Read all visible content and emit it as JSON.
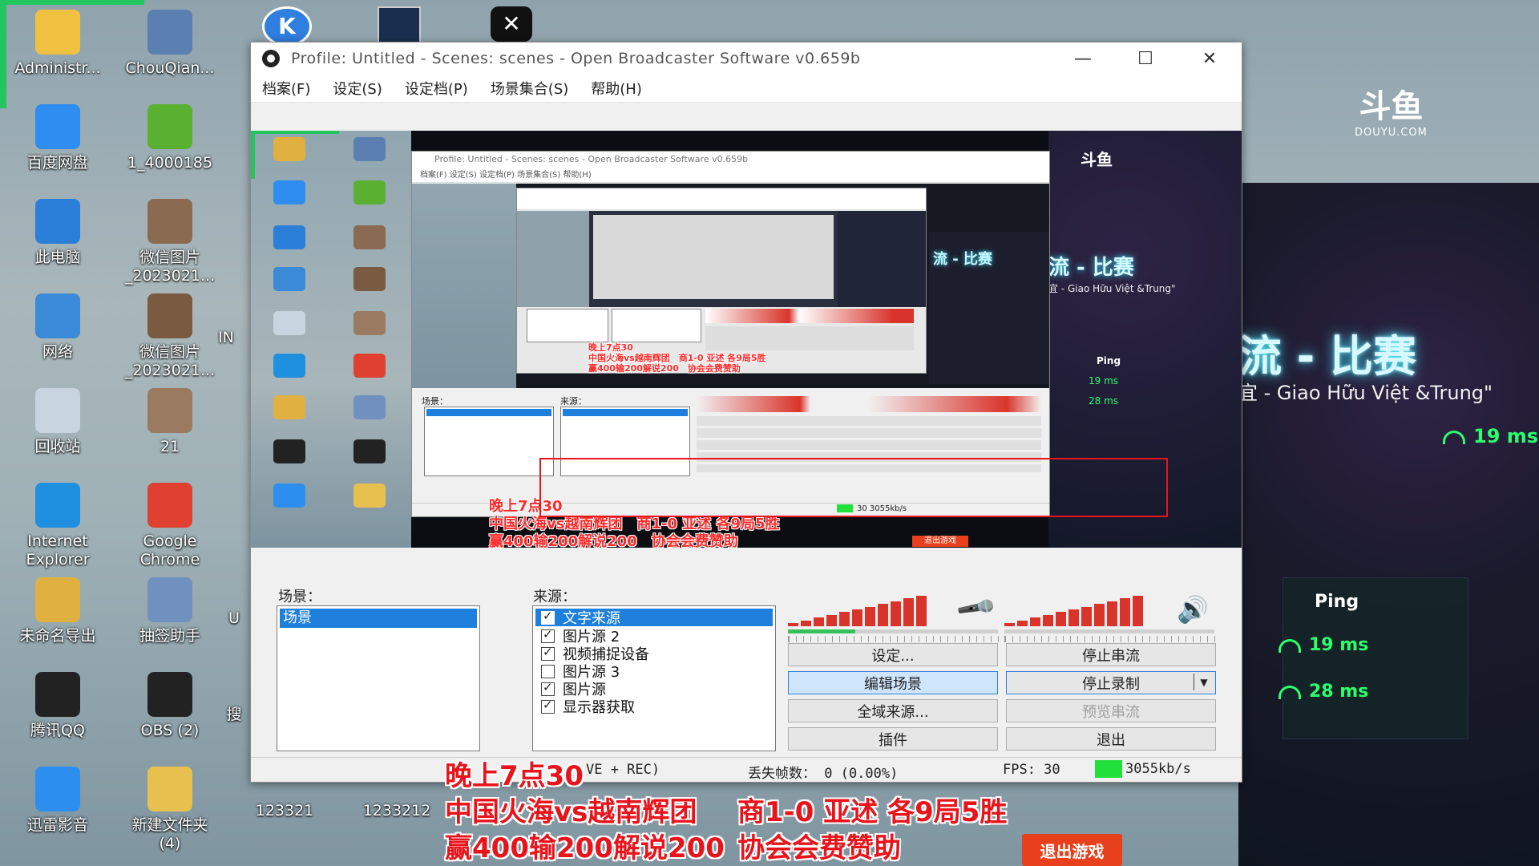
{
  "desktop": {
    "icons": [
      {
        "label": "Administr...",
        "icon": "user-folder-icon",
        "color": "#f0c040"
      },
      {
        "label": "ChouQian...",
        "icon": "network-tool-icon",
        "color": "#5a7fb0"
      },
      {
        "label": "百度网盘",
        "icon": "baidu-netdisk-icon",
        "color": "#2f8cf0"
      },
      {
        "label": "1_4000185",
        "icon": "green-app-icon",
        "color": "#5ab030"
      },
      {
        "label": "此电脑",
        "icon": "computer-icon",
        "color": "#2c7fd8"
      },
      {
        "label": "微信图片\n_2023021...",
        "icon": "image-file-icon",
        "color": "#8a6a50"
      },
      {
        "label": "网络",
        "icon": "network-icon",
        "color": "#3a8ad8"
      },
      {
        "label": "微信图片\n_2023021...",
        "icon": "image-file-icon",
        "color": "#7a5a40"
      },
      {
        "label": "回收站",
        "icon": "recycle-bin-icon",
        "color": "#c8d4e0"
      },
      {
        "label": "21",
        "icon": "image-file-icon",
        "color": "#9a7a60"
      },
      {
        "label": "Internet\nExplorer",
        "icon": "internet-explorer-icon",
        "color": "#1f8fe0"
      },
      {
        "label": "Google\nChrome",
        "icon": "chrome-icon",
        "color": "#e04030"
      },
      {
        "label": "未命名导出",
        "icon": "folder-icon",
        "color": "#e0b040"
      },
      {
        "label": "抽签助手",
        "icon": "search-tool-icon",
        "color": "#7090c0"
      },
      {
        "label": "腾讯QQ",
        "icon": "qq-penguin-icon",
        "color": "#222222"
      },
      {
        "label": "OBS (2)",
        "icon": "obs-icon",
        "color": "#222222"
      },
      {
        "label": "迅雷影音",
        "icon": "xunlei-player-icon",
        "color": "#2c8ff0"
      },
      {
        "label": "新建文件夹\n(4)",
        "icon": "folder-icon",
        "color": "#e8c050"
      }
    ],
    "partial_labels": [
      "IN",
      "U",
      "搜"
    ],
    "bottom_labels": [
      "123321",
      "1233212"
    ],
    "top_icons": [
      "k-app-icon",
      "screenshot-icon",
      "capcut-icon"
    ]
  },
  "obs": {
    "title": "Profile: Untitled - Scenes: scenes - Open Broadcaster Software v0.659b",
    "menu": [
      "档案(F)",
      "设定(S)",
      "设定档(P)",
      "场景集合(S)",
      "帮助(H)"
    ],
    "scenes_label": "场景：",
    "scenes": [
      "场景"
    ],
    "sources_label": "来源：",
    "sources": [
      {
        "label": "文字来源",
        "checked": true,
        "selected": true
      },
      {
        "label": "图片源 2",
        "checked": true,
        "selected": false
      },
      {
        "label": "视频捕捉设备",
        "checked": true,
        "selected": false
      },
      {
        "label": "图片源 3",
        "checked": false,
        "selected": false
      },
      {
        "label": "图片源",
        "checked": true,
        "selected": false
      },
      {
        "label": "显示器获取",
        "checked": true,
        "selected": false
      }
    ],
    "buttons": {
      "settings": "设定...",
      "stop_stream": "停止串流",
      "edit_scene": "编辑场景",
      "stop_record": "停止录制",
      "global_sources": "全域来源...",
      "preview_stream": "预览串流",
      "plugins": "插件",
      "exit": "退出"
    },
    "status": {
      "mode": "VE + REC)",
      "dropped": "丢失帧数： 0 (0.00%)",
      "fps": "FPS: 30",
      "bitrate": "3055kb/s"
    },
    "meter_mic_icon": "microphone-icon",
    "meter_speaker_icon": "speaker-icon"
  },
  "overlay": {
    "line1": "晚上7点30",
    "line2a": "中国火海vs越南辉团",
    "line2b": "商1-0 亚述 各9局5胜",
    "line3a": "赢400输200解说200",
    "line3b": "协会会费赞助",
    "exit_game": "退出游戏"
  },
  "stream": {
    "logo": "斗鱼",
    "logo_sub": "DOUYU.COM",
    "title": "流 - 比赛",
    "subtitle": "宜 - Giao Hữu Việt &Trung\"",
    "ping_header": "Ping",
    "ping_top": "19 ms",
    "ping_rows": [
      "19 ms",
      "28 ms"
    ]
  },
  "nested_preview": {
    "title": "Profile: Untitled - Scenes: scenes - Open Broadcaster Software v0.659b",
    "menu": "档案(F)  设定(S)  设定档(P)  场景集合(S)  帮助(H)",
    "overlay1": "晚上7点30",
    "overlay2": "中国火海vs越南辉团　商1-0 亚述 各9局5胜",
    "overlay3": "赢400输200解说200　协会会费赞助",
    "stream_title": "流 - 比赛",
    "stream_sub": "宜 - Giao Hữu Việt &Trung\"",
    "ping": "Ping",
    "ping_rows": [
      "19 ms",
      "28 ms"
    ],
    "exit_game": "退出游戏",
    "scenes_label": "场景：",
    "sources_label": "来源：",
    "status": "30    3055kb/s"
  }
}
